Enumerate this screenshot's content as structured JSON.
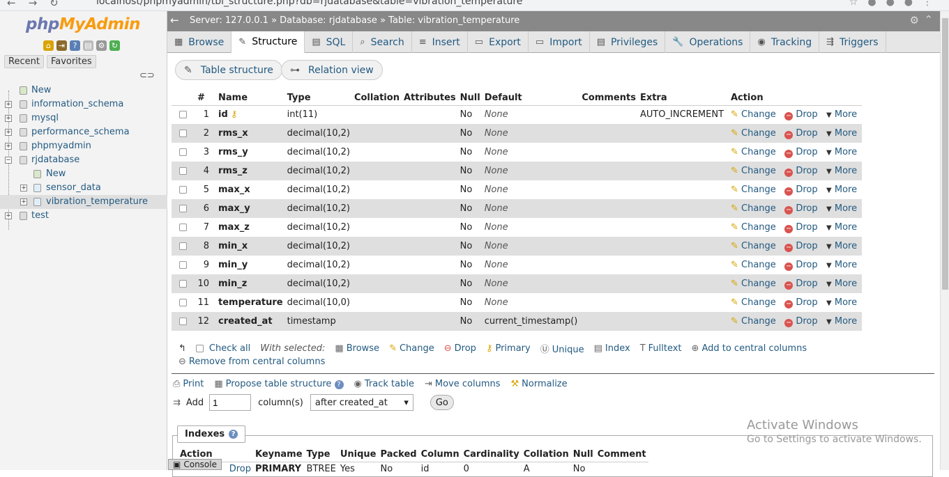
{
  "browser": {
    "url": "localhost/phpmyadmin/tbl_structure.php?db=rjdatabase&table=vibration_temperature"
  },
  "sidebar": {
    "logo_a": "php",
    "logo_b": "MyAdmin",
    "tab_recent": "Recent",
    "tab_favorites": "Favorites",
    "tree": [
      {
        "label": "New",
        "level": 0
      },
      {
        "label": "information_schema",
        "level": 0
      },
      {
        "label": "mysql",
        "level": 0
      },
      {
        "label": "performance_schema",
        "level": 0
      },
      {
        "label": "phpmyadmin",
        "level": 0
      },
      {
        "label": "rjdatabase",
        "level": 0
      },
      {
        "label": "New",
        "level": 1
      },
      {
        "label": "sensor_data",
        "level": 1
      },
      {
        "label": "vibration_temperature",
        "level": 1
      },
      {
        "label": "test",
        "level": 0
      }
    ]
  },
  "breadcrumb": {
    "server": "Server: 127.0.0.1",
    "database": "Database: rjdatabase",
    "table": "Table: vibration_temperature"
  },
  "menu": [
    "Browse",
    "Structure",
    "SQL",
    "Search",
    "Insert",
    "Export",
    "Import",
    "Privileges",
    "Operations",
    "Tracking",
    "Triggers"
  ],
  "subtabs": {
    "table_structure": "Table structure",
    "relation_view": "Relation view"
  },
  "columns_header": [
    "#",
    "Name",
    "Type",
    "Collation",
    "Attributes",
    "Null",
    "Default",
    "Comments",
    "Extra",
    "Action"
  ],
  "rows": [
    {
      "n": "1",
      "name": "id",
      "type": "int(11)",
      "null": "No",
      "default": "None",
      "extra": "AUTO_INCREMENT"
    },
    {
      "n": "2",
      "name": "rms_x",
      "type": "decimal(10,2)",
      "null": "No",
      "default": "None",
      "extra": ""
    },
    {
      "n": "3",
      "name": "rms_y",
      "type": "decimal(10,2)",
      "null": "No",
      "default": "None",
      "extra": ""
    },
    {
      "n": "4",
      "name": "rms_z",
      "type": "decimal(10,2)",
      "null": "No",
      "default": "None",
      "extra": ""
    },
    {
      "n": "5",
      "name": "max_x",
      "type": "decimal(10,2)",
      "null": "No",
      "default": "None",
      "extra": ""
    },
    {
      "n": "6",
      "name": "max_y",
      "type": "decimal(10,2)",
      "null": "No",
      "default": "None",
      "extra": ""
    },
    {
      "n": "7",
      "name": "max_z",
      "type": "decimal(10,2)",
      "null": "No",
      "default": "None",
      "extra": ""
    },
    {
      "n": "8",
      "name": "min_x",
      "type": "decimal(10,2)",
      "null": "No",
      "default": "None",
      "extra": ""
    },
    {
      "n": "9",
      "name": "min_y",
      "type": "decimal(10,2)",
      "null": "No",
      "default": "None",
      "extra": ""
    },
    {
      "n": "10",
      "name": "min_z",
      "type": "decimal(10,2)",
      "null": "No",
      "default": "None",
      "extra": ""
    },
    {
      "n": "11",
      "name": "temperature",
      "type": "decimal(10,0)",
      "null": "No",
      "default": "None",
      "extra": ""
    },
    {
      "n": "12",
      "name": "created_at",
      "type": "timestamp",
      "null": "No",
      "default": "current_timestamp()",
      "extra": ""
    }
  ],
  "row_actions": {
    "change": "Change",
    "drop": "Drop",
    "more": "More"
  },
  "bulk": {
    "check_all": "Check all",
    "with_selected": "With selected:",
    "browse": "Browse",
    "change": "Change",
    "drop": "Drop",
    "primary": "Primary",
    "unique": "Unique",
    "index": "Index",
    "fulltext": "Fulltext",
    "add_central": "Add to central columns",
    "remove_central": "Remove from central columns"
  },
  "tools": {
    "print": "Print",
    "propose": "Propose table structure",
    "track": "Track table",
    "move": "Move columns",
    "normalize": "Normalize"
  },
  "add": {
    "label": "Add",
    "value": "1",
    "unit": "column(s)",
    "position": "after created_at",
    "go": "Go"
  },
  "indexes": {
    "title": "Indexes",
    "header": [
      "Action",
      "Keyname",
      "Type",
      "Unique",
      "Packed",
      "Column",
      "Cardinality",
      "Collation",
      "Null",
      "Comment"
    ],
    "row": {
      "drop": "Drop",
      "keyname": "PRIMARY",
      "type": "BTREE",
      "unique": "Yes",
      "packed": "No",
      "column": "id",
      "cardinality": "0",
      "collation": "A",
      "null": "No"
    }
  },
  "watermark": {
    "line1": "Activate Windows",
    "line2": "Go to Settings to activate Windows."
  },
  "console": "Console"
}
